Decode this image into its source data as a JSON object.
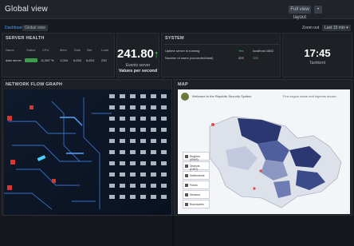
{
  "window": {
    "title": "Global view"
  },
  "titlebar": {
    "button1": "Full view layout",
    "button2": "•"
  },
  "subnav": {
    "tabs": [
      {
        "label": "Dashboard",
        "active": true
      },
      {
        "label": "Global view",
        "active": false
      }
    ],
    "right": {
      "filter_label": "Zoom out",
      "date_label": "Last 15 min ▾"
    }
  },
  "server_panel": {
    "title": "Server health",
    "columns": [
      "Name",
      "Status",
      "CPU",
      "Mem",
      "Disk",
      "Net",
      "Load"
    ],
    "row": {
      "name": "data server",
      "cpu": "11,567 %",
      "mem": "1,034",
      "disk": "6,634",
      "net": "6,824",
      "load": "230"
    }
  },
  "kpi": {
    "value": "241.80",
    "arrow": "↑",
    "label": "Events server",
    "sublabel": "Values per second"
  },
  "system_panel": {
    "title": "System",
    "rows": [
      {
        "label": "Uptime server is running",
        "status": "Yes",
        "value": "localhost:1883"
      },
      {
        "label": "Number of users (connected/total)",
        "status": "329",
        "value": "100"
      }
    ]
  },
  "clock": {
    "time": "17:45",
    "sublabel": "Tashkent"
  },
  "network_panel": {
    "title": "Network flow graph"
  },
  "map_panel": {
    "title": "Map",
    "header_text": "Welcome to the Republic Security System",
    "header_right": "Find region name and legends shown",
    "legend": [
      "Regions (SNHI)",
      "Districts (DIST)",
      "Settlements",
      "Points",
      "Streams",
      "Boundaries"
    ]
  },
  "colors": {
    "accent": "#4aa3ff",
    "up": "#4fd16a",
    "map_dark": "#2b3770",
    "map_mid": "#4f5f9d",
    "map_light": "#dfe3ee"
  }
}
